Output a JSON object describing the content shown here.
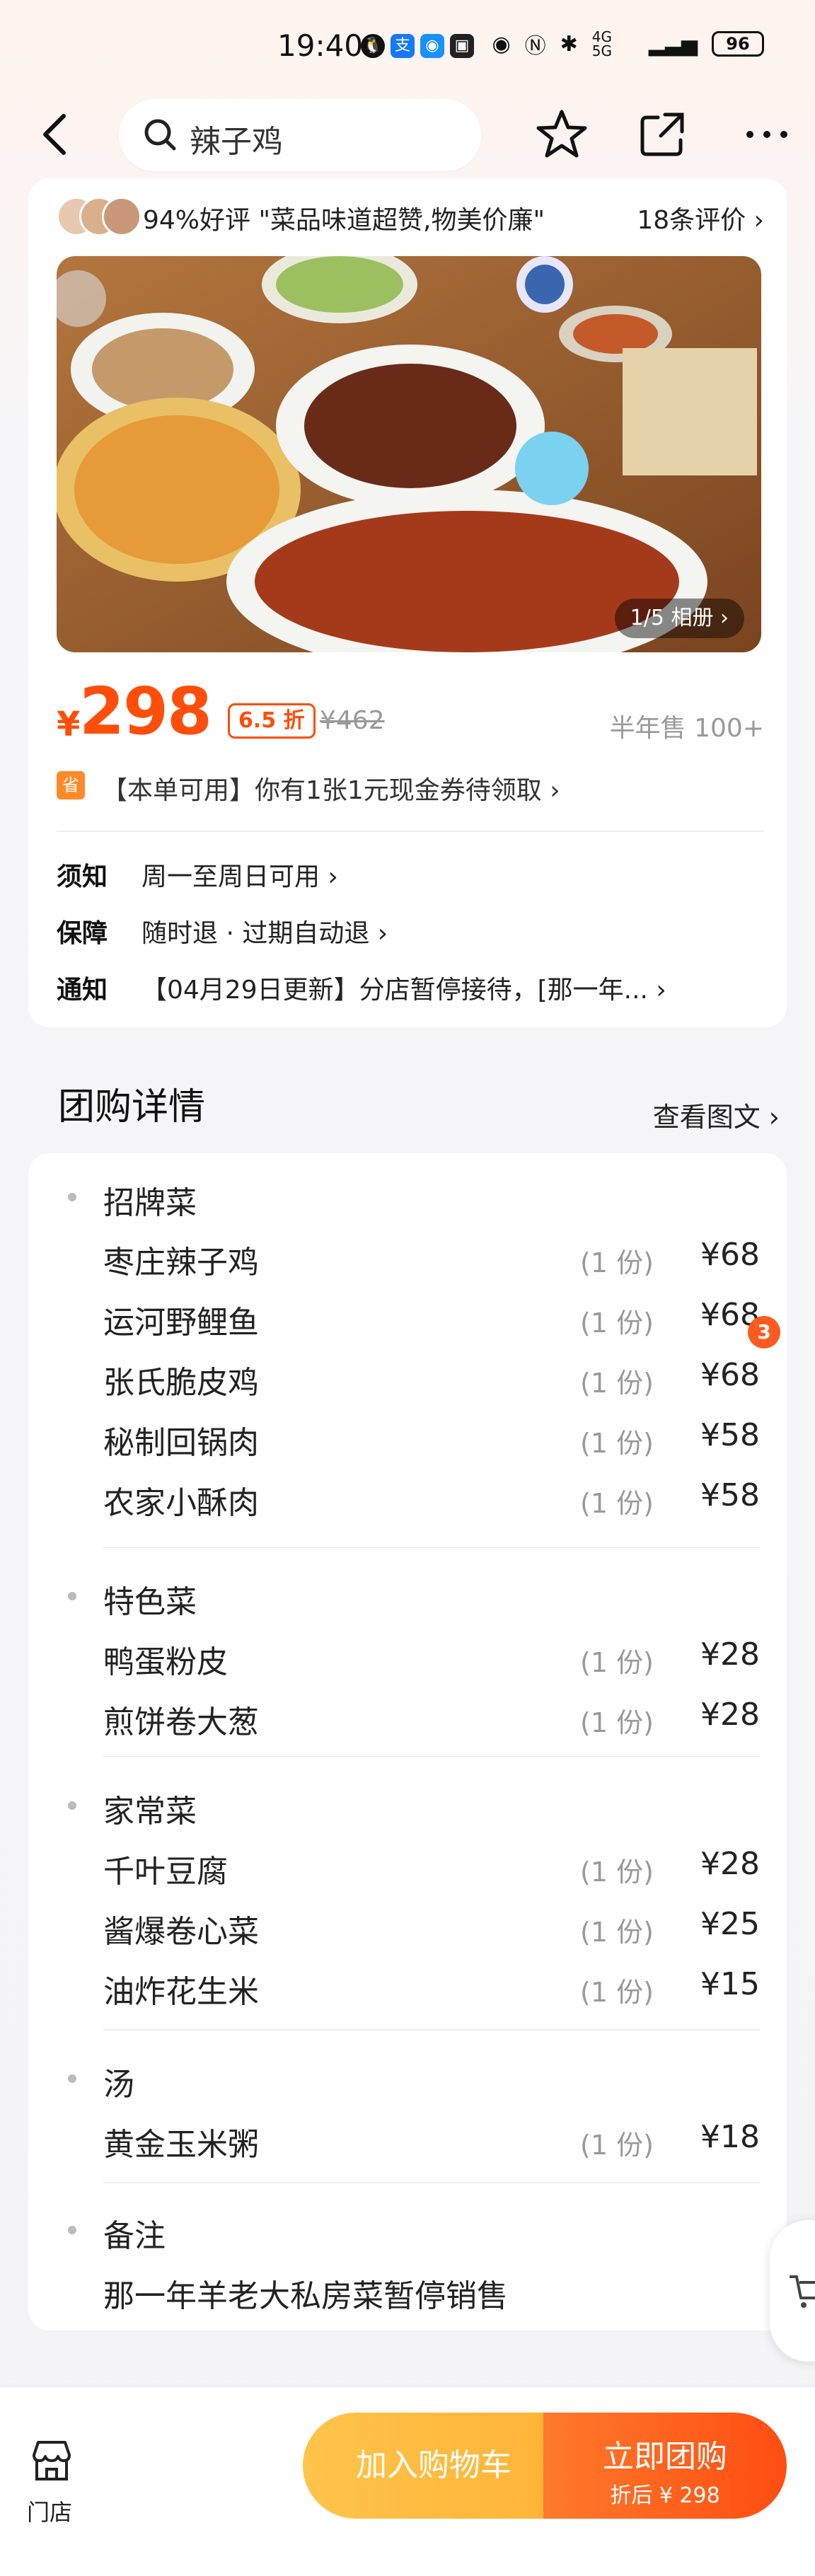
{
  "status_bar": {
    "time": "19:40",
    "network": "4G 5G",
    "battery": "96"
  },
  "nav": {
    "search_text": "辣子鸡"
  },
  "review": {
    "summary": "94%好评 \"菜品味道超赞,物美价廉\"",
    "count": "18条评价 ›"
  },
  "photo": {
    "counter": "1/5 相册 ›"
  },
  "price": {
    "symbol": "¥",
    "value": "298",
    "discount": "6.5 折",
    "original": "¥462",
    "sold": "半年售 100+"
  },
  "coupon": {
    "tag": "省",
    "text": "【本单可用】你有1张1元现金券待领取 ›"
  },
  "info": [
    {
      "label": "须知",
      "value": "周一至周日可用 ›"
    },
    {
      "label": "保障",
      "value": "随时退 · 过期自动退 ›"
    },
    {
      "label": "通知",
      "value": "【04月29日更新】分店暂停接待，[那一年...  ›"
    }
  ],
  "section": {
    "title": "团购详情",
    "view_detail": "查看图文 ›"
  },
  "categories": [
    {
      "name": "招牌菜",
      "items": [
        {
          "name": "枣庄辣子鸡",
          "qty": "(1 份)",
          "price": "¥68"
        },
        {
          "name": "运河野鲤鱼",
          "qty": "(1 份)",
          "price": "¥68"
        },
        {
          "name": "张氏脆皮鸡",
          "qty": "(1 份)",
          "price": "¥68"
        },
        {
          "name": "秘制回锅肉",
          "qty": "(1 份)",
          "price": "¥58"
        },
        {
          "name": "农家小酥肉",
          "qty": "(1 份)",
          "price": "¥58"
        }
      ]
    },
    {
      "name": "特色菜",
      "items": [
        {
          "name": "鸭蛋粉皮",
          "qty": "(1 份)",
          "price": "¥28"
        },
        {
          "name": "煎饼卷大葱",
          "qty": "(1 份)",
          "price": "¥28"
        }
      ]
    },
    {
      "name": "家常菜",
      "items": [
        {
          "name": "千叶豆腐",
          "qty": "(1 份)",
          "price": "¥28"
        },
        {
          "name": "酱爆卷心菜",
          "qty": "(1 份)",
          "price": "¥25"
        },
        {
          "name": "油炸花生米",
          "qty": "(1 份)",
          "price": "¥15"
        }
      ]
    },
    {
      "name": "汤",
      "items": [
        {
          "name": "黄金玉米粥",
          "qty": "(1 份)",
          "price": "¥18"
        }
      ]
    },
    {
      "name": "备注",
      "note": "那一年羊老大私房菜暂停销售"
    }
  ],
  "badge": "3",
  "bottom": {
    "store_label": "门店",
    "cart_label": "加入购物车",
    "buy_label": "立即团购",
    "buy_sub": "折后 ¥ 298"
  },
  "colors": {
    "accent": "#ff4e0a",
    "cart": "#ffb336",
    "buy": "#ff5a1f"
  }
}
